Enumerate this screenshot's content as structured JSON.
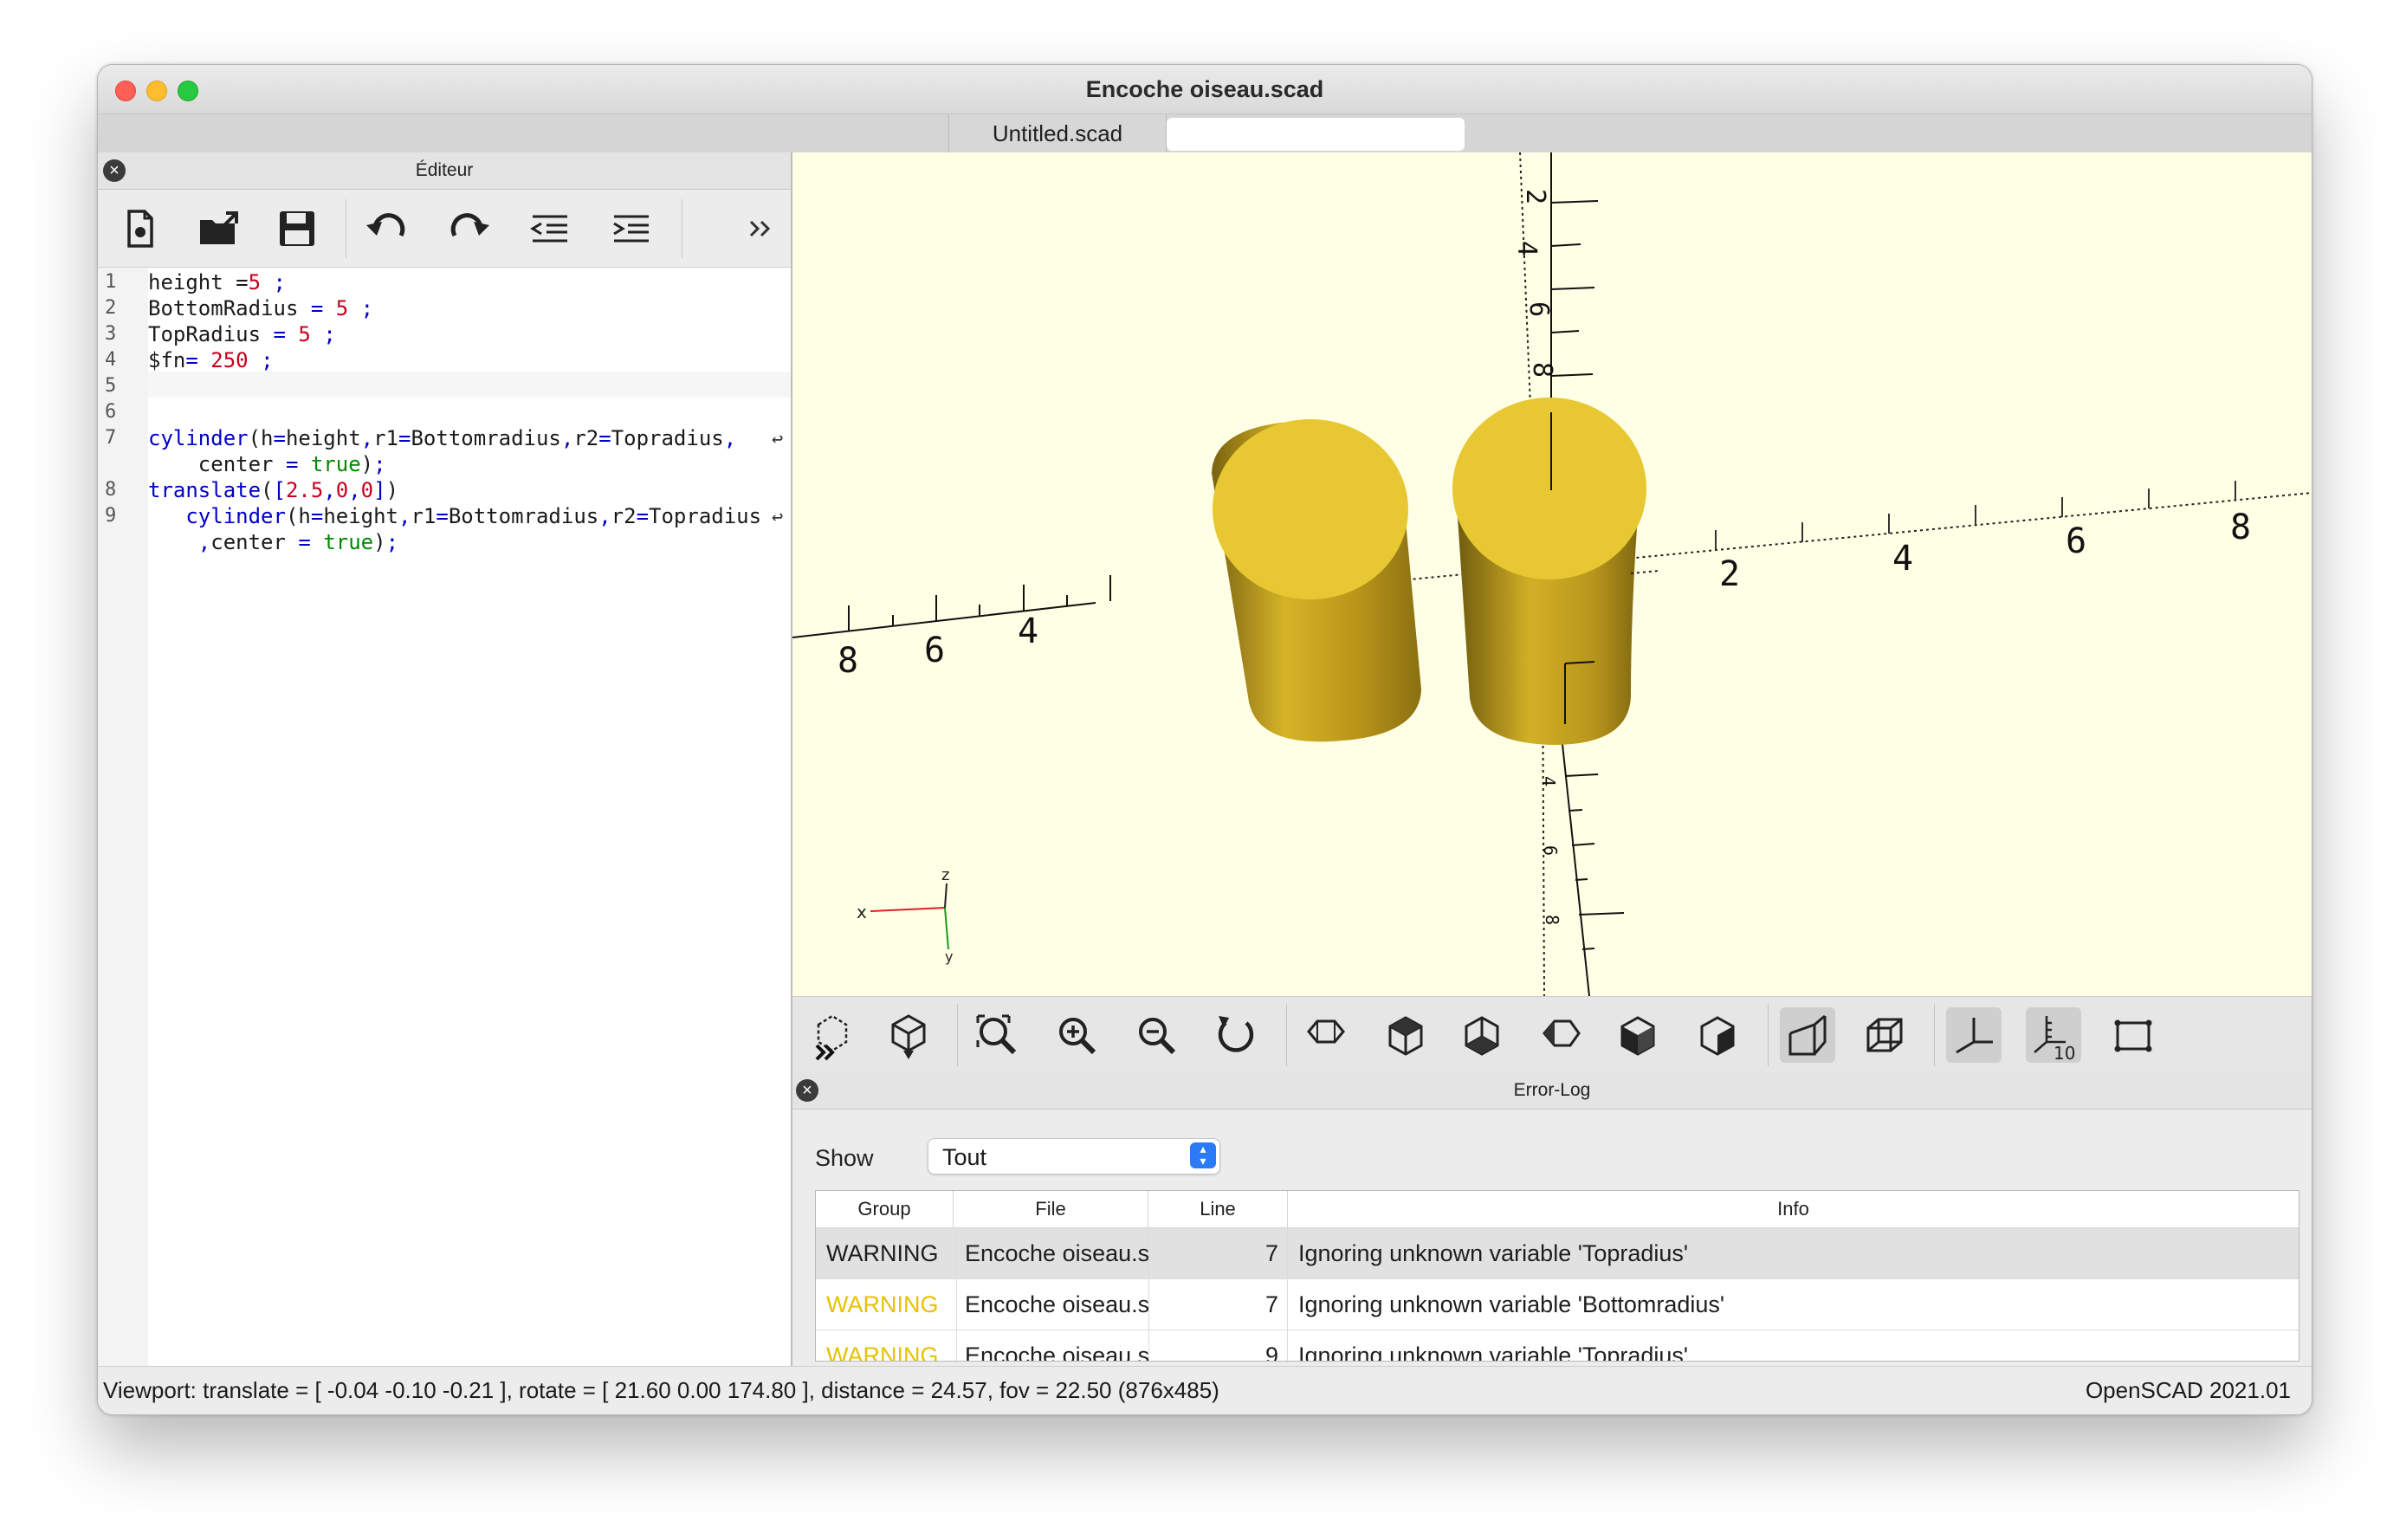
{
  "window": {
    "title": "Encoche oiseau.scad"
  },
  "tabs": [
    {
      "label": "Untitled.scad"
    },
    {
      "label": ""
    }
  ],
  "editor": {
    "panel_title": "Éditeur",
    "toolbar": [
      "new-file-icon",
      "open-file-icon",
      "save-icon",
      "undo-icon",
      "redo-icon",
      "unindent-icon",
      "indent-icon",
      "more-icon"
    ],
    "line_numbers": [
      "1",
      "2",
      "3",
      "4",
      "5",
      "6",
      "7",
      "",
      "8",
      "9",
      ""
    ],
    "wrap_mark": "↩"
  },
  "viewport": {
    "axis_labels": {
      "x": "x",
      "y": "y",
      "z": "z"
    },
    "scale_marks": [
      "8",
      "6",
      "4",
      "2",
      "4",
      "6",
      "8",
      "2",
      "4",
      "6",
      "8",
      "2",
      "4",
      "6",
      "8"
    ],
    "object_color": "#e8c832",
    "background": "#ffffe5"
  },
  "view_toolbar": [
    "preview-icon",
    "render-icon",
    "view-all-icon",
    "zoom-in-icon",
    "zoom-out-icon",
    "reset-view-icon",
    "view-right-icon",
    "view-top-icon",
    "view-bottom-icon",
    "view-left-icon",
    "view-front-icon",
    "view-back-icon",
    "perspective-icon",
    "orthogonal-icon",
    "show-axes-icon",
    "show-scale-icon",
    "show-edges-icon"
  ],
  "errorlog": {
    "title": "Error-Log",
    "show_label": "Show",
    "filter_value": "Tout",
    "columns": [
      "Group",
      "File",
      "Line",
      "Info"
    ],
    "rows": [
      {
        "group": "WARNING",
        "file": "Encoche oiseau.scad",
        "line": "7",
        "info": "Ignoring unknown variable 'Topradius'"
      },
      {
        "group": "WARNING",
        "file": "Encoche oiseau.scad",
        "line": "7",
        "info": "Ignoring unknown variable 'Bottomradius'"
      },
      {
        "group": "WARNING",
        "file": "Encoche oiseau.scad",
        "line": "9",
        "info": "Ignoring unknown variable 'Topradius'"
      }
    ],
    "warning_color": "#e6c200"
  },
  "status": {
    "viewport": "Viewport: translate = [ -0.04 -0.10 -0.21 ], rotate = [ 21.60 0.00 174.80 ], distance = 24.57, fov = 22.50 (876x485)",
    "version": "OpenSCAD 2021.01"
  }
}
